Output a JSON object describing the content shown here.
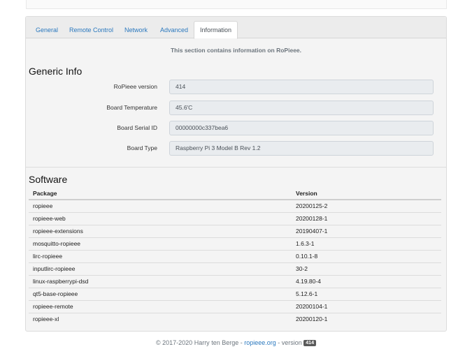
{
  "tabs": [
    {
      "label": "General"
    },
    {
      "label": "Remote Control"
    },
    {
      "label": "Network"
    },
    {
      "label": "Advanced"
    },
    {
      "label": "Information",
      "active": true
    }
  ],
  "intro_text": "This section contains information on RoPieee.",
  "generic_info": {
    "title": "Generic Info",
    "fields": [
      {
        "label": "RoPieee version",
        "value": "414"
      },
      {
        "label": "Board Temperature",
        "value": "45.6'C"
      },
      {
        "label": "Board Serial ID",
        "value": "00000000c337bea6"
      },
      {
        "label": "Board Type",
        "value": "Raspberry Pi 3 Model B Rev 1.2"
      }
    ]
  },
  "software": {
    "title": "Software",
    "columns": {
      "package": "Package",
      "version": "Version"
    },
    "rows": [
      {
        "package": "ropieee",
        "version": "20200125-2"
      },
      {
        "package": "ropieee-web",
        "version": "20200128-1"
      },
      {
        "package": "ropieee-extensions",
        "version": "20190407-1"
      },
      {
        "package": "mosquitto-ropieee",
        "version": "1.6.3-1"
      },
      {
        "package": "lirc-ropieee",
        "version": "0.10.1-8"
      },
      {
        "package": "inputlirc-ropieee",
        "version": "30-2"
      },
      {
        "package": "linux-raspberrypi-dsd",
        "version": "4.19.80-4"
      },
      {
        "package": "qt5-base-ropieee",
        "version": "5.12.6-1"
      },
      {
        "package": "ropieee-remote",
        "version": "20200104-1"
      },
      {
        "package": "ropieee-xl",
        "version": "20200120-1"
      }
    ]
  },
  "footer": {
    "copyright": "© 2017-2020 Harry ten Berge - ",
    "link": "ropieee.org",
    "version_text": " - version ",
    "version_badge": "414"
  }
}
